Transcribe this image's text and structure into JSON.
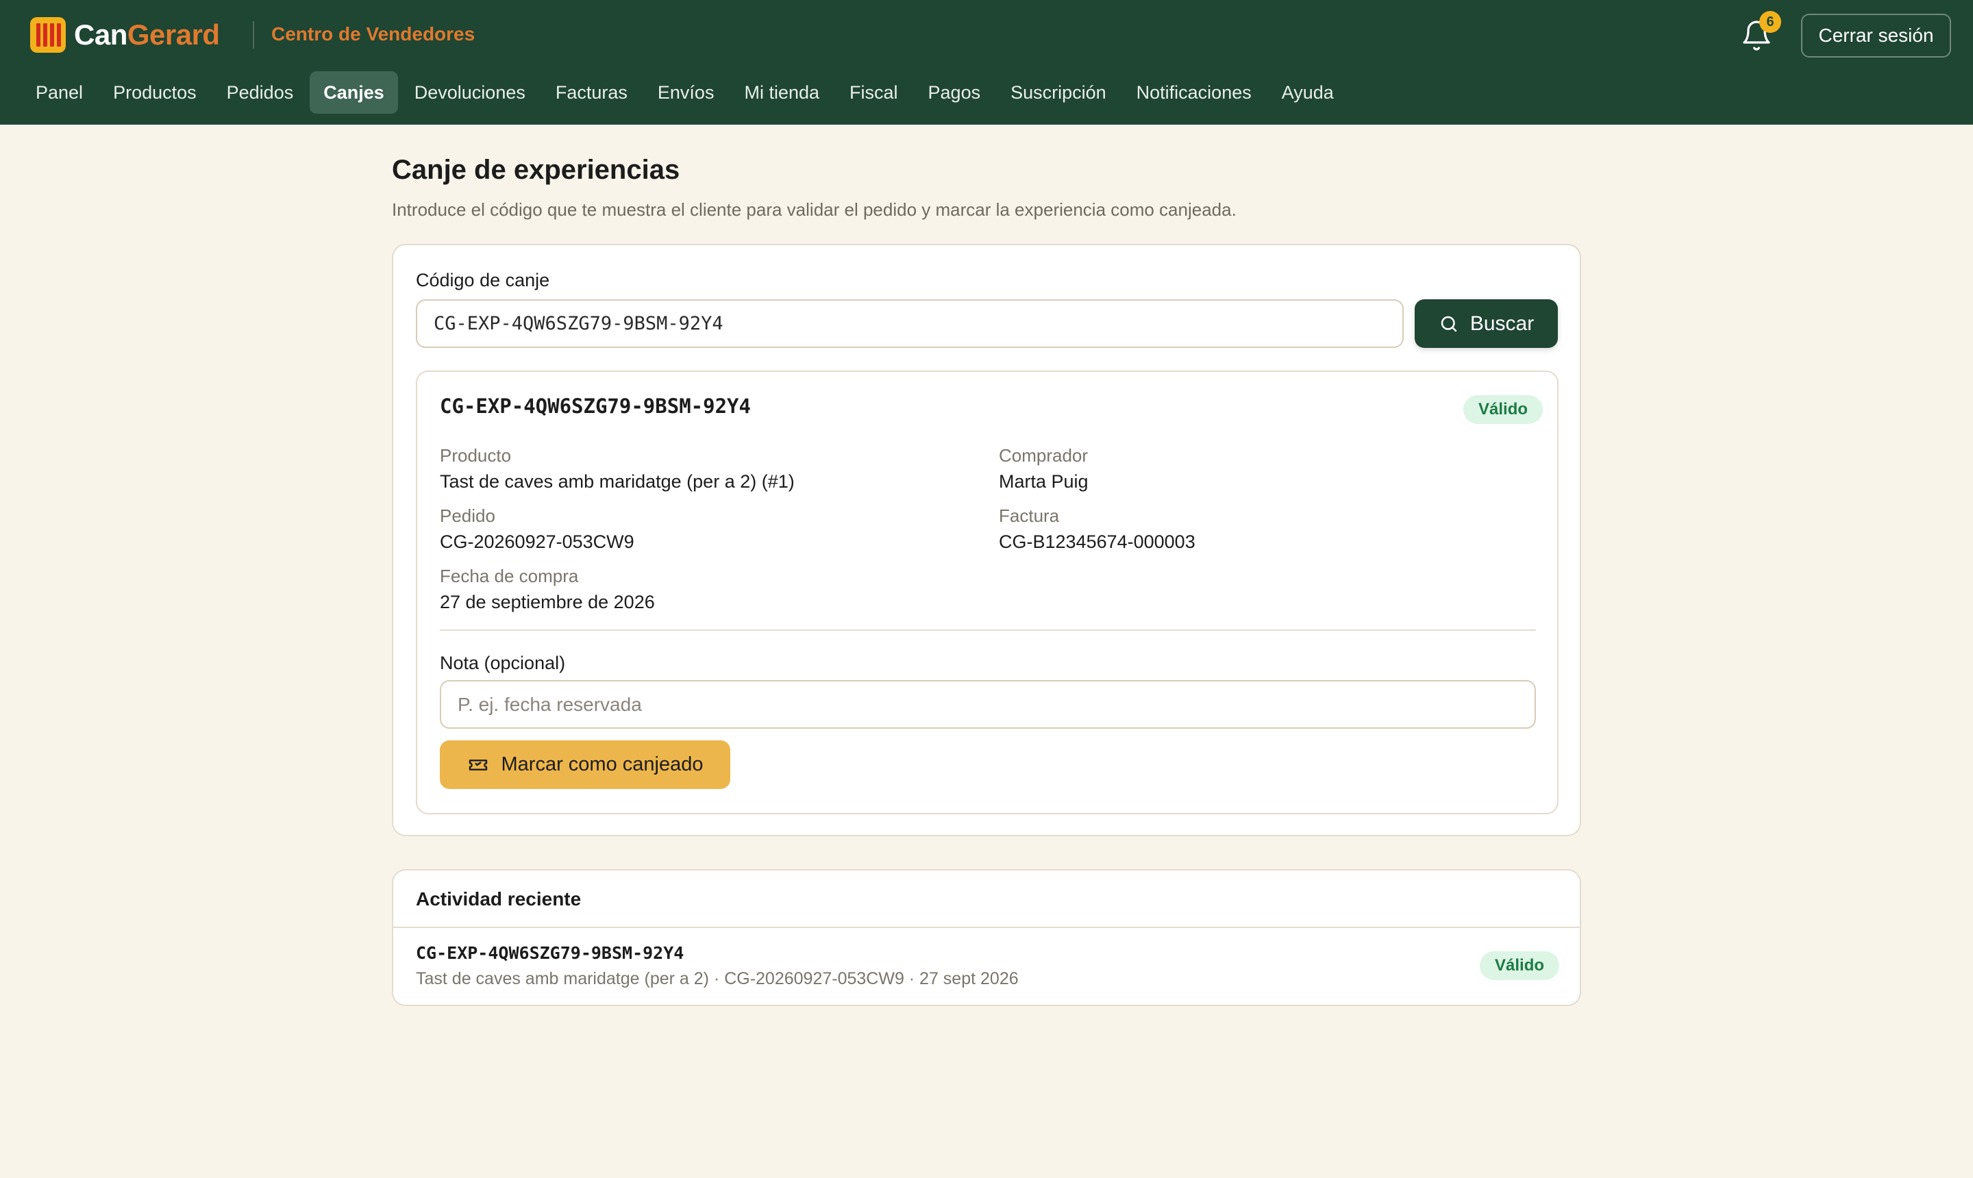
{
  "brand": {
    "name_part1": "Can",
    "name_part2": "Gerard",
    "subtitle": "Centro de Vendedores"
  },
  "header": {
    "notifications_count": "6",
    "logout_label": "Cerrar sesión"
  },
  "nav": {
    "items": [
      {
        "label": "Panel"
      },
      {
        "label": "Productos"
      },
      {
        "label": "Pedidos"
      },
      {
        "label": "Canjes",
        "active": true
      },
      {
        "label": "Devoluciones"
      },
      {
        "label": "Facturas"
      },
      {
        "label": "Envíos"
      },
      {
        "label": "Mi tienda"
      },
      {
        "label": "Fiscal"
      },
      {
        "label": "Pagos"
      },
      {
        "label": "Suscripción"
      },
      {
        "label": "Notificaciones"
      },
      {
        "label": "Ayuda"
      }
    ]
  },
  "page": {
    "title": "Canje de experiencias",
    "description": "Introduce el código que te muestra el cliente para validar el pedido y marcar la experiencia como canjeada."
  },
  "search": {
    "label": "Código de canje",
    "value": "CG-EXP-4QW6SZG79-9BSM-92Y4",
    "button_label": "Buscar"
  },
  "result": {
    "code": "CG-EXP-4QW6SZG79-9BSM-92Y4",
    "status": "Válido",
    "status_color": "#1e7a45",
    "product_label": "Producto",
    "product_value": "Tast de caves amb maridatge (per a 2) (#1)",
    "buyer_label": "Comprador",
    "buyer_value": "Marta Puig",
    "order_label": "Pedido",
    "order_value": "CG-20260927-053CW9",
    "invoice_label": "Factura",
    "invoice_value": "CG-B12345674-000003",
    "purchase_date_label": "Fecha de compra",
    "purchase_date_value": "27 de septiembre de 2026",
    "note_label": "Nota (opcional)",
    "note_placeholder": "P. ej. fecha reservada",
    "note_value": "",
    "redeem_button_label": "Marcar como canjeado"
  },
  "activity": {
    "title": "Actividad reciente",
    "items": [
      {
        "code": "CG-EXP-4QW6SZG79-9BSM-92Y4",
        "meta": "Tast de caves amb maridatge (per a 2) · CG-20260927-053CW9 · 27 sept 2026",
        "status": "Válido"
      }
    ]
  },
  "colors": {
    "header_bg": "#1f4533",
    "accent_orange": "#e07a2e",
    "accent_yellow": "#edb64c",
    "page_bg": "#f8f4ea",
    "valid_badge_bg": "#dcf5e5"
  }
}
